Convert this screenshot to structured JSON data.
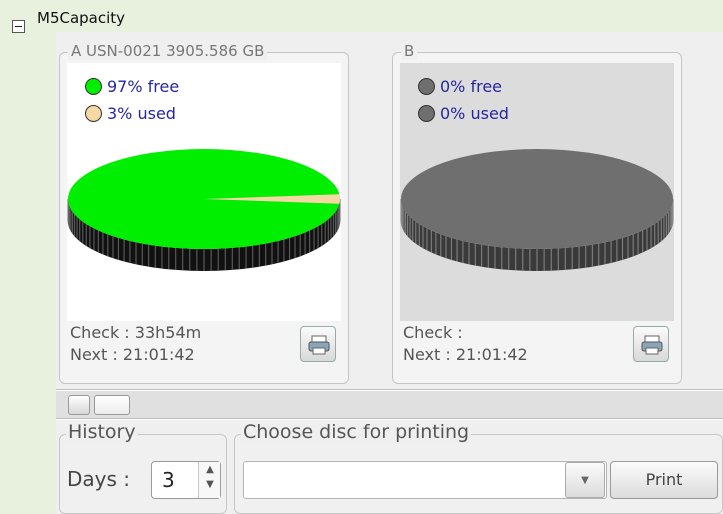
{
  "header": {
    "title": "M5Capacity",
    "collapse_icon": "minus-box-icon"
  },
  "discs": [
    {
      "legend": "A USN-0021  3905.586 GB",
      "free_label": "97% free",
      "used_label": "3% used",
      "free_color": "#00ee00",
      "used_color": "#f5d8a4",
      "free_fraction": 0.97,
      "check_text": "Check : 33h54m",
      "next_text": "Next  : 21:01:42"
    },
    {
      "legend": "B",
      "free_label": "0% free",
      "used_label": "0% used",
      "free_color": "#6f6f6f",
      "used_color": "#6f6f6f",
      "free_fraction": 0,
      "check_text": "Check :",
      "next_text": "Next  : 21:01:42"
    }
  ],
  "history": {
    "legend": "History",
    "days_label": "Days :",
    "days_value": "3"
  },
  "choose": {
    "legend": "Choose disc for printing",
    "selected": "",
    "print_label": "Print"
  }
}
